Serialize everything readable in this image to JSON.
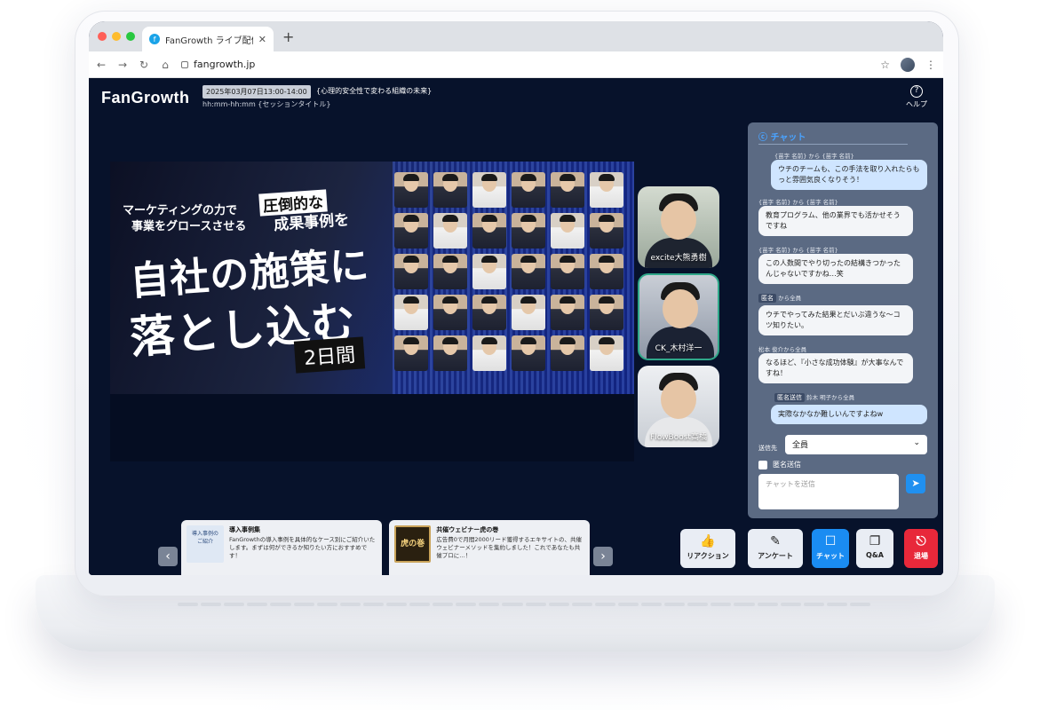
{
  "browser": {
    "tab_title": "FanGrowth ライブ配信...",
    "url": "fangrowth.jp"
  },
  "header": {
    "logo": "FanGrowth",
    "date_badge": "2025年03月07日13:00-14:00",
    "session_title": "{心理的安全性で変わる組織の未来}",
    "session_sub": "hh:mm-hh:mm {セッションタイトル}",
    "help_label": "ヘルプ"
  },
  "banner": {
    "line1": "マーケティングの力で",
    "line2": "事業をグロースさせる",
    "accent1": "圧倒的な",
    "accent2": "成果事例を",
    "big1": "自社の施策に",
    "big2": "落とし込む",
    "days": "2日間"
  },
  "speakers": [
    {
      "name": "excite大熊勇樹"
    },
    {
      "name": "CK_木村洋一"
    },
    {
      "name": "FlowBoost高橋"
    }
  ],
  "chat": {
    "title": "チャット",
    "messages": [
      {
        "meta": "{苗字 名前} から {苗字 名前}",
        "text": "ウチのチームも、この手法を取り入れたらもっと雰囲気良くなりそう！"
      },
      {
        "meta": "{苗字 名前} から {苗字 名前}",
        "text": "教育プログラム、他の業界でも活かせそうですね"
      },
      {
        "meta": "{苗字 名前} から {苗字 名前}",
        "text": "この人数間でやり切ったの結構きつかったんじゃないですかね…笑"
      },
      {
        "meta_anon": "匿名",
        "meta": "から全員",
        "text": "ウチでやってみた結果とだいぶ違うな〜コツ知りたい。"
      },
      {
        "meta": "松本 俊介から全員",
        "text": "なるほど、『小さな成功体験』が大事なんですね！"
      },
      {
        "meta_anon": "匿名送信",
        "meta": "鈴木 明子から全員",
        "text": "実際なかなか難しいんですよねw"
      }
    ],
    "send_to_label": "送信先",
    "send_to_value": "全員",
    "anon_label": "匿名送信",
    "input_placeholder": "チャットを送信"
  },
  "cards": [
    {
      "thumb": "導入事例のご紹介",
      "title": "導入事例集",
      "body": "FanGrowthの導入事例を具体的なケース別にご紹介いたします。まずは何ができるか知りたい方におすすめです！"
    },
    {
      "thumb": "虎の巻",
      "title": "共催ウェビナー虎の巻",
      "body": "広告費0で月間2000リード獲得するエキサイトの、共催ウェビナーメソッドを集約しました！これであなたも共催プロに…！"
    }
  ],
  "actions": [
    {
      "label": "リアクション",
      "icon": "thumbs-up-icon"
    },
    {
      "label": "アンケート",
      "icon": "pencil-icon"
    },
    {
      "label": "チャット",
      "icon": "chat-icon"
    },
    {
      "label": "Q&A",
      "icon": "qa-icon"
    },
    {
      "label": "退場",
      "icon": "exit-icon"
    }
  ]
}
